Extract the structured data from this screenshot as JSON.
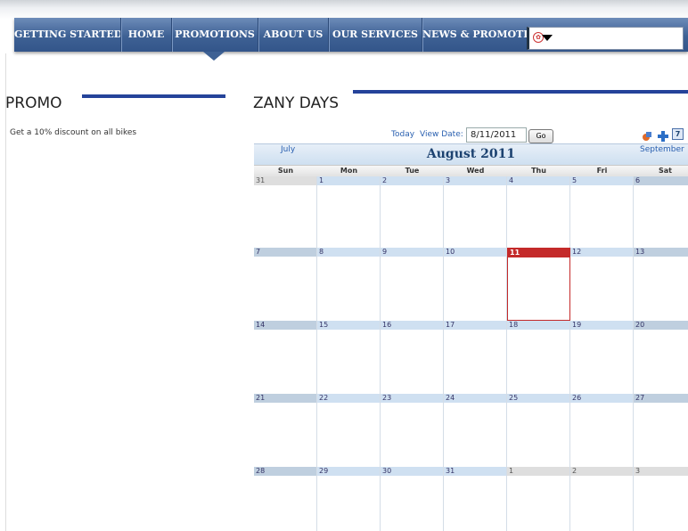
{
  "nav": {
    "tabs": [
      "GETTING STARTED",
      "HOME",
      "PROMOTIONS",
      "ABOUT US",
      "OUR SERVICES",
      "NEWS & PROMOTIONS"
    ],
    "active_tab": "PROMOTIONS",
    "language_icon": "flag-icon"
  },
  "promo": {
    "title": "PROMO",
    "text": "Get a 10% discount on all bikes"
  },
  "calendar": {
    "section_title": "ZANY DAYS",
    "today_label": "Today",
    "view_date_label": "View Date:",
    "view_date_value": "8/11/2011",
    "go_label": "Go",
    "prev_month": "July",
    "next_month": "September",
    "month_title": "August 2011",
    "days_of_week": [
      "Sun",
      "Mon",
      "Tue",
      "Wed",
      "Thu",
      "Fri",
      "Sat"
    ],
    "weeks": [
      [
        "31",
        "1",
        "2",
        "3",
        "4",
        "5",
        "6"
      ],
      [
        "7",
        "8",
        "9",
        "10",
        "11",
        "12",
        "13"
      ],
      [
        "14",
        "15",
        "16",
        "17",
        "18",
        "19",
        "20"
      ],
      [
        "21",
        "22",
        "23",
        "24",
        "25",
        "26",
        "27"
      ],
      [
        "28",
        "29",
        "30",
        "31",
        "1",
        "2",
        "3"
      ]
    ],
    "today_day": "11",
    "accent_color": "#c42a2a",
    "nav_color": "#3e6194",
    "underline_color": "#25439a"
  }
}
